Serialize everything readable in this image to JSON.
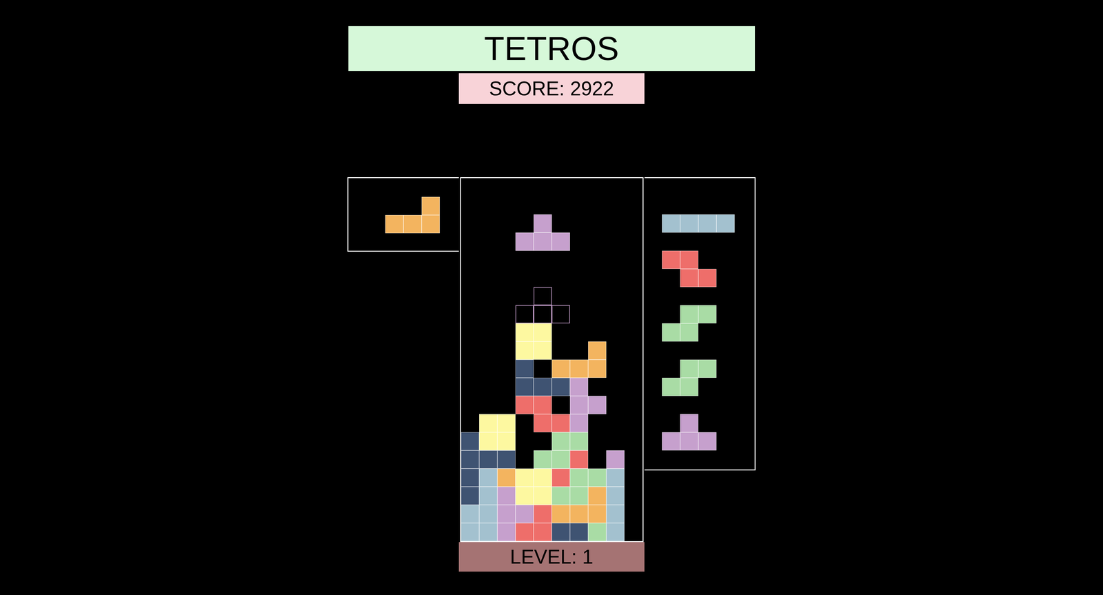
{
  "title": "TETROS",
  "score": "SCORE: 2922",
  "level": "LEVEL: 1",
  "colors": {
    "Y": "#fdf8a0",
    "O": "#f3b45f",
    "N": "#3f5372",
    "P": "#c6a0cd",
    "R": "#ee6e6a",
    "G": "#a9dca5",
    "B": "#a3c1cf"
  },
  "board": {
    "rows": [
      "..........",
      "..........",
      "..........",
      "..........",
      "..........",
      "..........",
      "..........",
      "..........",
      "...YY.....",
      "...YY..O..",
      "...N.OOO..",
      "...NNNP...",
      "...RR.PP..",
      ".YY.RRP...",
      "NYY..GG...",
      "NNN.GGR.P.",
      "NBOYYRGGB.",
      "NBPYYGGOB.",
      "BBPPROOOB.",
      "BBPRRNNGB."
    ]
  },
  "active_piece": {
    "kind": "P",
    "cells": [
      [
        2,
        4
      ],
      [
        3,
        3
      ],
      [
        3,
        4
      ],
      [
        3,
        5
      ]
    ]
  },
  "ghost_piece": {
    "kind": "P",
    "cells": [
      [
        6,
        4
      ],
      [
        7,
        3
      ],
      [
        7,
        4
      ],
      [
        7,
        5
      ]
    ]
  },
  "hold": {
    "kind": "O",
    "shape": [
      "..O",
      "OOO"
    ]
  },
  "next": [
    {
      "kind": "B",
      "shape": [
        "BBBB"
      ]
    },
    {
      "kind": "R",
      "shape": [
        "RR.",
        ".RR"
      ]
    },
    {
      "kind": "G",
      "shape": [
        ".GG",
        "GG."
      ]
    },
    {
      "kind": "G",
      "shape": [
        ".GG",
        "GG."
      ]
    },
    {
      "kind": "P",
      "shape": [
        ".P.",
        "PPP"
      ]
    }
  ]
}
